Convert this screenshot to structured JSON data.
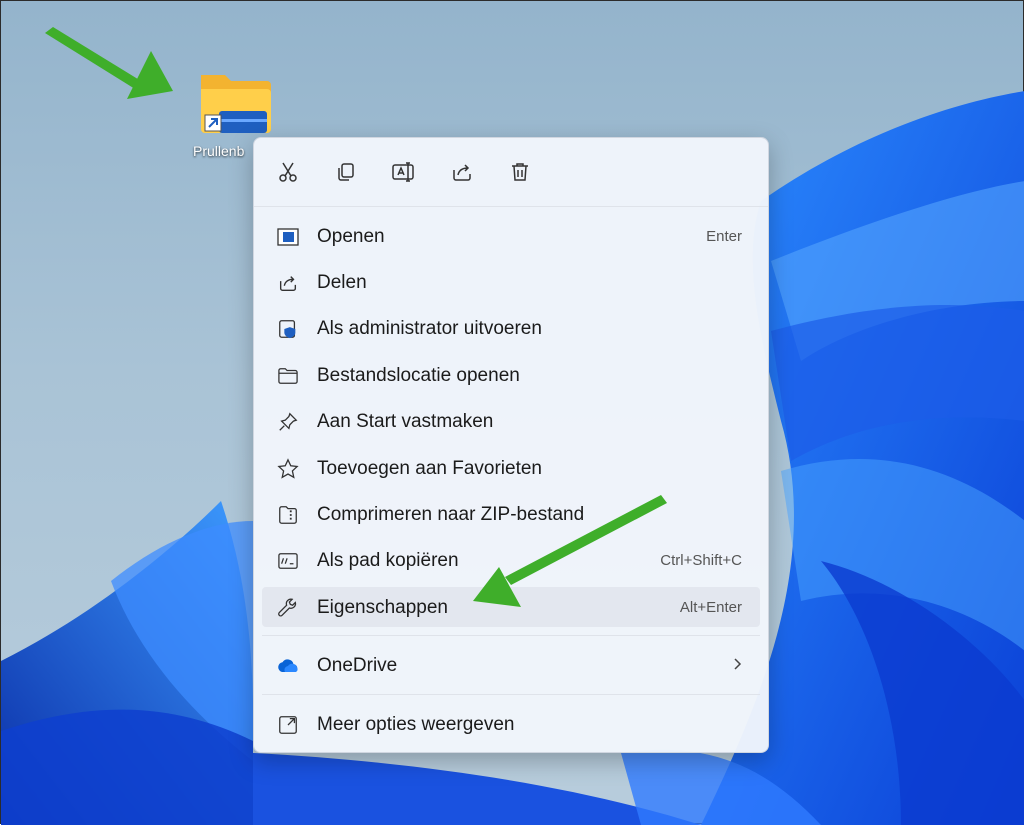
{
  "desktop": {
    "icon_label": "Prullenb",
    "icon_name": "folder-shortcut-icon"
  },
  "toolbar": {
    "buttons": [
      {
        "name": "cut-icon"
      },
      {
        "name": "copy-icon"
      },
      {
        "name": "rename-icon"
      },
      {
        "name": "share-icon"
      },
      {
        "name": "delete-icon"
      }
    ]
  },
  "menu": {
    "items": [
      {
        "label": "Openen",
        "shortcut": "Enter",
        "icon": "open-icon"
      },
      {
        "label": "Delen",
        "shortcut": "",
        "icon": "share-icon"
      },
      {
        "label": "Als administrator uitvoeren",
        "shortcut": "",
        "icon": "admin-shield-icon"
      },
      {
        "label": "Bestandslocatie openen",
        "shortcut": "",
        "icon": "folder-icon"
      },
      {
        "label": "Aan Start vastmaken",
        "shortcut": "",
        "icon": "pin-icon"
      },
      {
        "label": "Toevoegen aan Favorieten",
        "shortcut": "",
        "icon": "star-icon"
      },
      {
        "label": "Comprimeren naar ZIP-bestand",
        "shortcut": "",
        "icon": "zip-icon"
      },
      {
        "label": "Als pad kopiëren",
        "shortcut": "Ctrl+Shift+C",
        "icon": "copy-path-icon"
      },
      {
        "label": "Eigenschappen",
        "shortcut": "Alt+Enter",
        "icon": "wrench-icon",
        "highlighted": true
      },
      {
        "label": "OneDrive",
        "shortcut": "",
        "icon": "onedrive-cloud-icon",
        "submenu": true
      },
      {
        "label": "Meer opties weergeven",
        "shortcut": "",
        "icon": "more-options-icon"
      }
    ]
  },
  "colors": {
    "accent_blue": "#0067c0",
    "arrow_green": "#3fae2a",
    "highlight": "#e3e7ef"
  }
}
